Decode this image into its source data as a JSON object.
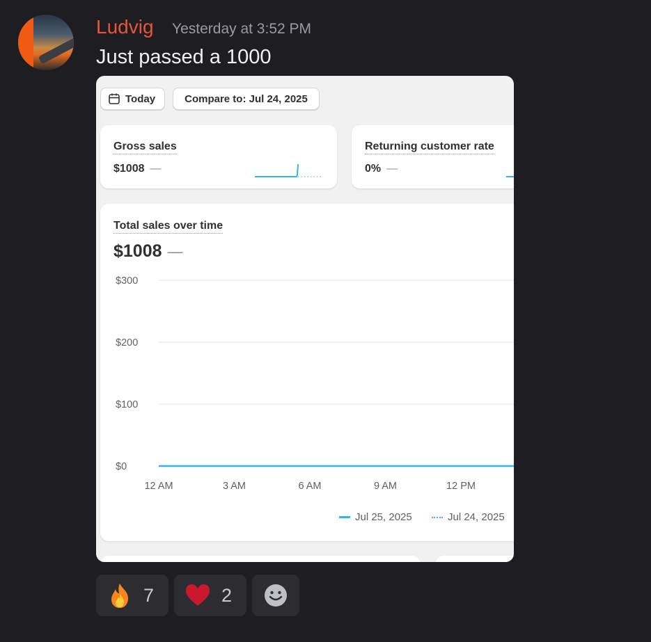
{
  "message": {
    "username": "Ludvig",
    "timestamp": "Yesterday at 3:52 PM",
    "text": "Just passed a 1000",
    "username_color": "#e8553d"
  },
  "screenshot": {
    "filters": {
      "date_label": "Today",
      "compare_label": "Compare to: Jul 24, 2025"
    },
    "metrics": [
      {
        "title": "Gross sales",
        "value": "$1008",
        "change": "—"
      },
      {
        "title": "Returning customer rate",
        "value": "0%",
        "change": "—"
      }
    ],
    "total_sales": {
      "title": "Total sales over time",
      "value": "$1008",
      "change": "—"
    },
    "accent_color": "#34b4e8"
  },
  "chart_data": {
    "type": "line",
    "title": "Total sales over time",
    "x": [
      "12 AM",
      "3 AM",
      "6 AM",
      "9 AM",
      "12 PM"
    ],
    "y_ticks": [
      "$300",
      "$200",
      "$100",
      "$0"
    ],
    "ylim": [
      0,
      300
    ],
    "grid": true,
    "series": [
      {
        "name": "Jul 25, 2025",
        "style": "solid",
        "values": [
          0,
          0,
          0,
          0,
          0
        ]
      },
      {
        "name": "Jul 24, 2025",
        "style": "dotted",
        "values": []
      }
    ],
    "legend": "bottom-right"
  },
  "reactions": [
    {
      "icon": "fire-icon",
      "count": "7"
    },
    {
      "icon": "heart-icon",
      "count": "2"
    },
    {
      "icon": "add-reaction-icon",
      "count": ""
    }
  ]
}
